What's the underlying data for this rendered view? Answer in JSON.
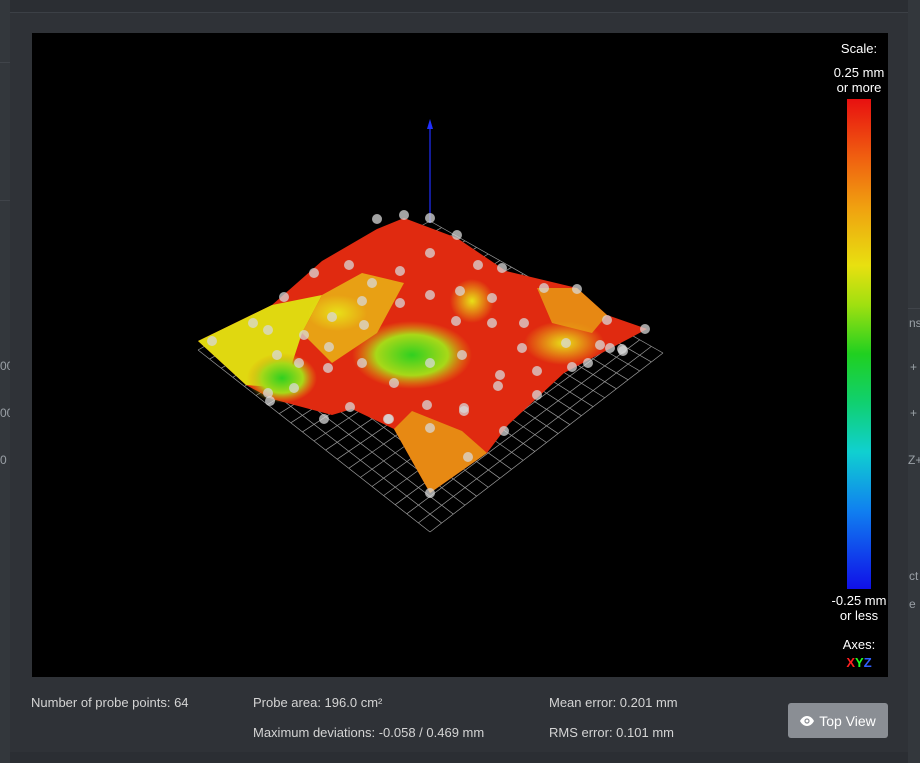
{
  "viewer": {
    "scale_title": "Scale:",
    "scale_max": "0.25 mm\nor more",
    "scale_min": "-0.25 mm\nor less",
    "axes_title": "Axes:",
    "axes": {
      "x": "X",
      "y": "Y",
      "z": "Z"
    }
  },
  "stats": {
    "probe_points": "Number of probe points: 64",
    "probe_area": "Probe area: 196.0 cm²",
    "max_deviations": "Maximum deviations: -0.058 / 0.469 mm",
    "mean_error": "Mean error: 0.201 mm",
    "rms_error": "RMS error: 0.101 mm"
  },
  "button": {
    "top_view": "Top View",
    "icon": "eye-icon"
  },
  "background": {
    "fragments": [
      "00",
      "00",
      "0",
      "Z+",
      "ns",
      "+",
      "+",
      "ct",
      "e"
    ]
  },
  "colors": {
    "scale_high": "#e81010",
    "scale_low": "#1010e8",
    "button": "#8a8e94"
  }
}
